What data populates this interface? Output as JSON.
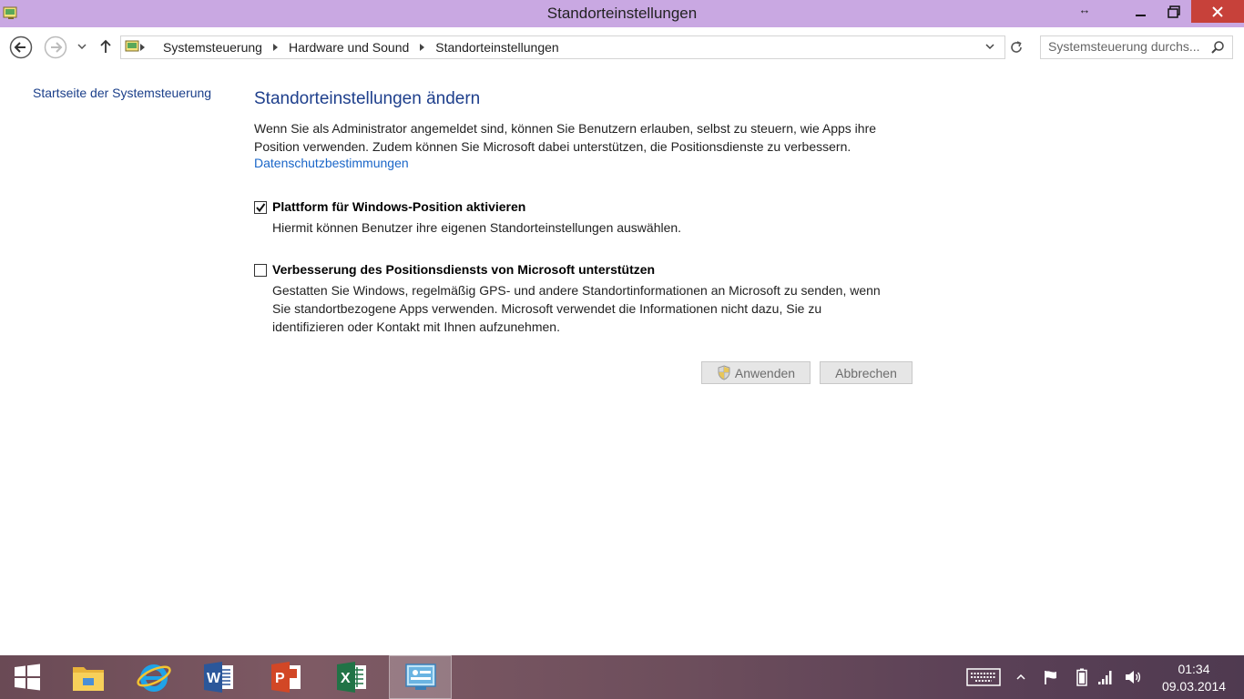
{
  "window": {
    "title": "Standorteinstellungen"
  },
  "address": {
    "crumbs": [
      "Systemsteuerung",
      "Hardware und Sound",
      "Standorteinstellungen"
    ]
  },
  "search": {
    "placeholder": "Systemsteuerung durchs..."
  },
  "sidebar": {
    "home_link": "Startseite der Systemsteuerung"
  },
  "main": {
    "title": "Standorteinstellungen ändern",
    "intro_line1": "Wenn Sie als Administrator angemeldet sind, können Sie Benutzern erlauben, selbst zu steuern, wie Apps ihre",
    "intro_line2": "Position verwenden. Zudem können Sie Microsoft dabei unterstützen, die Positionsdienste zu verbessern.",
    "privacy_link": "Datenschutzbestimmungen",
    "options": [
      {
        "label": "Plattform für Windows-Position aktivieren",
        "checked": true,
        "desc_lines": [
          "Hiermit können Benutzer ihre eigenen Standorteinstellungen auswählen."
        ]
      },
      {
        "label": "Verbesserung des Positionsdiensts von Microsoft unterstützen",
        "checked": false,
        "desc_lines": [
          "Gestatten Sie Windows, regelmäßig GPS- und andere Standortinformationen an Microsoft zu senden, wenn",
          "Sie standortbezogene Apps verwenden. Microsoft verwendet die Informationen nicht dazu, Sie zu",
          "identifizieren oder Kontakt mit Ihnen aufzunehmen."
        ]
      }
    ],
    "apply_label": "Anwenden",
    "cancel_label": "Abbrechen"
  },
  "taskbar": {
    "time": "01:34",
    "date": "09.03.2014",
    "apps": [
      "start",
      "file-explorer",
      "internet-explorer",
      "word",
      "powerpoint",
      "excel",
      "control-panel"
    ]
  },
  "colors": {
    "titlebar": "#c9a8e2",
    "close": "#c7413a",
    "heading": "#1e3f8c",
    "link": "#1a66c8"
  }
}
